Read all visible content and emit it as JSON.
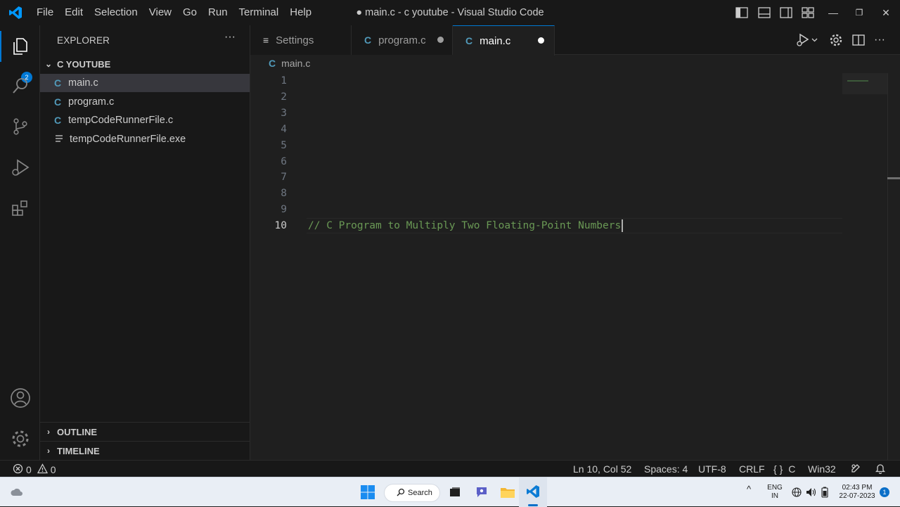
{
  "titlebar": {
    "menus": [
      "File",
      "Edit",
      "Selection",
      "View",
      "Go",
      "Run",
      "Terminal",
      "Help"
    ],
    "window_title": "● main.c - c youtube - Visual Studio Code",
    "controls": {
      "minimize": "—",
      "maximize": "❐",
      "close": "✕"
    }
  },
  "activitybar": {
    "explorer_badge": "2",
    "icons": [
      "explorer-icon",
      "search-icon",
      "source-control-icon",
      "run-debug-icon",
      "extensions-icon",
      "accounts-icon",
      "manage-gear-icon"
    ]
  },
  "sidebar": {
    "title": "EXPLORER",
    "more": "···",
    "folder": "C YOUTUBE",
    "files": [
      {
        "name": "main.c",
        "type": "c"
      },
      {
        "name": "program.c",
        "type": "c"
      },
      {
        "name": "tempCodeRunnerFile.c",
        "type": "c"
      },
      {
        "name": "tempCodeRunnerFile.exe",
        "type": "exe"
      }
    ],
    "outline": "OUTLINE",
    "timeline": "TIMELINE"
  },
  "tabs": {
    "items": [
      {
        "label": "Settings",
        "glyph": "≡"
      },
      {
        "label": "program.c",
        "glyph": "C"
      },
      {
        "label": "main.c",
        "glyph": "C"
      }
    ],
    "file_glyph": "C"
  },
  "breadcrumb": {
    "glyph": "C",
    "file": "main.c"
  },
  "editor": {
    "line_numbers": [
      "1",
      "2",
      "3",
      "4",
      "5",
      "6",
      "7",
      "8",
      "9",
      "10"
    ],
    "current_line": "10",
    "line10_code": "// C Program to Multiply Two Floating-Point Numbers"
  },
  "statusbar": {
    "errors": "0",
    "warnings": "0",
    "position": "Ln 10, Col 52",
    "spaces": "Spaces: 4",
    "encoding": "UTF-8",
    "eol": "CRLF",
    "language": "C",
    "language_braces": "{ }",
    "platform": "Win32"
  },
  "taskbar": {
    "search_label": "Search",
    "lang_top": "ENG",
    "lang_bottom": "IN",
    "time": "02:43 PM",
    "date": "22-07-2023",
    "notification_count": "1",
    "chevron": "^"
  },
  "colors": {
    "accent": "#0078d4",
    "comment": "#6a9955",
    "c_icon": "#519aba"
  }
}
